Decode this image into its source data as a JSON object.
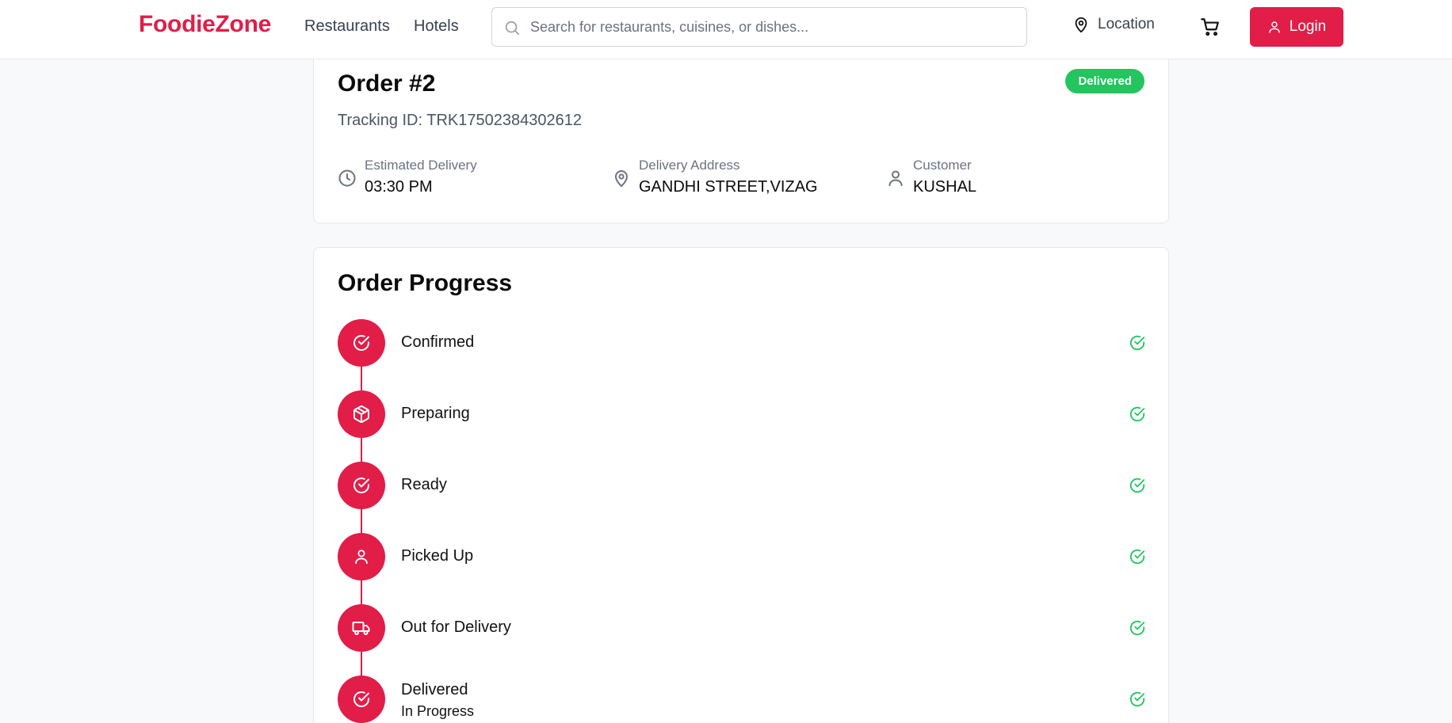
{
  "nav": {
    "logo": "FoodieZone",
    "links": [
      "Restaurants",
      "Hotels"
    ],
    "search_placeholder": "Search for restaurants, cuisines, or dishes...",
    "location_label": "Location",
    "login_label": "Login"
  },
  "order": {
    "title": "Order #2",
    "status": "Delivered",
    "tracking": "Tracking ID: TRK17502384302612",
    "info": [
      {
        "label": "Estimated Delivery",
        "value": "03:30 PM",
        "icon": "clock-icon"
      },
      {
        "label": "Delivery Address",
        "value": "GANDHI STREET,VIZAG",
        "icon": "map-pin-icon"
      },
      {
        "label": "Customer",
        "value": "KUSHAL",
        "icon": "user-icon"
      }
    ]
  },
  "progress": {
    "title": "Order Progress",
    "steps": [
      {
        "label": "Confirmed",
        "icon": "check-circle-icon"
      },
      {
        "label": "Preparing",
        "icon": "package-icon"
      },
      {
        "label": "Ready",
        "icon": "check-circle-icon"
      },
      {
        "label": "Picked Up",
        "icon": "user-icon"
      },
      {
        "label": "Out for Delivery",
        "icon": "truck-icon"
      },
      {
        "label": "Delivered",
        "sub": "In Progress",
        "icon": "check-circle-icon"
      }
    ]
  },
  "colors": {
    "brand": "#e11d48",
    "success": "#22c55e"
  }
}
